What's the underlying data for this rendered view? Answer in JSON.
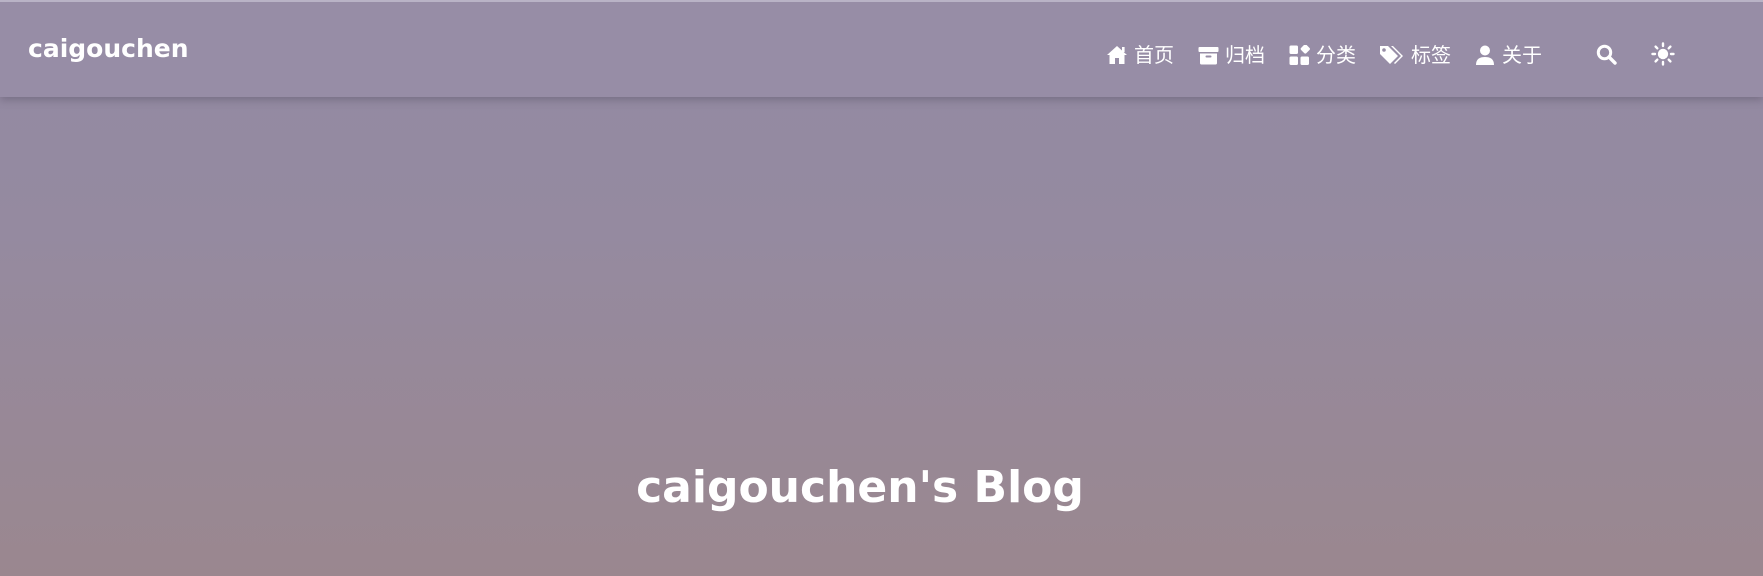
{
  "brand": {
    "name": "caigouchen"
  },
  "nav": {
    "items": [
      {
        "label": "首页",
        "icon": "home-icon"
      },
      {
        "label": "归档",
        "icon": "archive-icon"
      },
      {
        "label": "分类",
        "icon": "category-icon"
      },
      {
        "label": "标签",
        "icon": "tags-icon"
      },
      {
        "label": "关于",
        "icon": "user-icon"
      }
    ],
    "search_icon": "search-icon",
    "theme_icon": "sun-icon"
  },
  "hero": {
    "title": "caigouchen's Blog"
  },
  "colors": {
    "navbar_bg": "#978da6",
    "gradient_top": "#928aa3",
    "gradient_bottom": "#9a878f",
    "text": "#ffffff"
  }
}
